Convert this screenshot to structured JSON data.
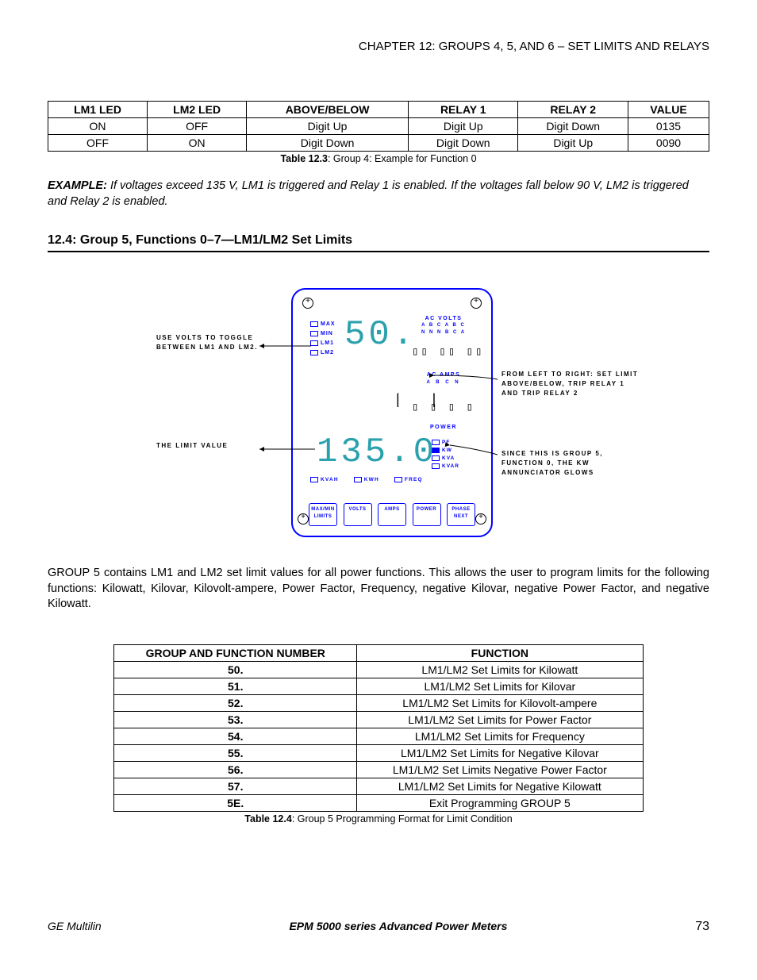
{
  "header": {
    "chapter": "CHAPTER 12: GROUPS 4, 5, AND 6 – SET LIMITS AND RELAYS"
  },
  "table1": {
    "headers": [
      "LM1 LED",
      "LM2 LED",
      "ABOVE/BELOW",
      "RELAY 1",
      "RELAY 2",
      "VALUE"
    ],
    "rows": [
      [
        "ON",
        "OFF",
        "Digit Up",
        "Digit Up",
        "Digit Down",
        "0135"
      ],
      [
        "OFF",
        "ON",
        "Digit Down",
        "Digit Down",
        "Digit Up",
        "0090"
      ]
    ],
    "caption_bold": "Table 12.3",
    "caption_rest": ": Group 4: Example for Function 0"
  },
  "example": {
    "lead": "EXAMPLE:",
    "text": "  If voltages exceed 135 V, LM1 is triggered and Relay 1 is enabled.  If the voltages fall below 90 V, LM2 is triggered and Relay 2 is enabled."
  },
  "section": {
    "title": "12.4: Group 5, Functions 0–7—LM1/LM2 Set Limits"
  },
  "diagram": {
    "leds": [
      "MAX",
      "MIN",
      "LM1",
      "LM2"
    ],
    "seg_top": "50.",
    "acvolts": "AC VOLTS",
    "acvolts_sub1": "A B C A B C",
    "acvolts_sub2": "N  N  N  B  C  A",
    "lcd_row1": "▯▯ ▯▯ ▯▯",
    "acamps": "AC AMPS",
    "abcn": "A B C N",
    "lcd_row2": "▯ ▯ ▯ ▯",
    "power": "POWER",
    "pf_items": [
      "PF",
      "KW",
      "KVA",
      "KVAR"
    ],
    "seg_bottom": "135.0",
    "bottom_items": [
      "KVAH",
      "KWH",
      "FREQ"
    ],
    "buttons": [
      "MAX/MIN LIMITS",
      "VOLTS",
      "AMPS",
      "POWER",
      "PHASE NEXT"
    ],
    "ann_left1": "USE VOLTS TO TOGGLE BETWEEN LM1 AND LM2.",
    "ann_left2": "THE LIMIT VALUE",
    "ann_right1": "FROM LEFT TO RIGHT: SET LIMIT ABOVE/BELOW, TRIP RELAY 1 AND TRIP RELAY 2",
    "ann_right2": "SINCE THIS IS GROUP 5, FUNCTION 0, THE KW ANNUNCIATOR GLOWS"
  },
  "body": {
    "p1": "GROUP 5 contains LM1 and LM2 set limit values for all power functions. This allows the user to program limits for the following functions: Kilowatt, Kilovar, Kilovolt-ampere, Power Factor, Frequency, negative Kilovar, negative Power Factor, and negative Kilowatt."
  },
  "table2": {
    "headers": [
      "GROUP AND FUNCTION NUMBER",
      "FUNCTION"
    ],
    "rows": [
      [
        "50.",
        "LM1/LM2 Set Limits for Kilowatt"
      ],
      [
        "51.",
        "LM1/LM2 Set Limits for Kilovar"
      ],
      [
        "52.",
        "LM1/LM2 Set Limits for Kilovolt-ampere"
      ],
      [
        "53.",
        "LM1/LM2 Set Limits for Power Factor"
      ],
      [
        "54.",
        "LM1/LM2 Set Limits for Frequency"
      ],
      [
        "55.",
        "LM1/LM2 Set Limits for Negative Kilovar"
      ],
      [
        "56.",
        "LM1/LM2 Set Limits Negative Power Factor"
      ],
      [
        "57.",
        "LM1/LM2 Set Limits for Negative Kilowatt"
      ],
      [
        "5E.",
        "Exit Programming GROUP 5"
      ]
    ],
    "caption_bold": "Table 12.4",
    "caption_rest": ": Group 5 Programming Format for Limit Condition"
  },
  "footer": {
    "left": "GE Multilin",
    "mid": "EPM 5000 series Advanced Power Meters",
    "right": "73"
  }
}
